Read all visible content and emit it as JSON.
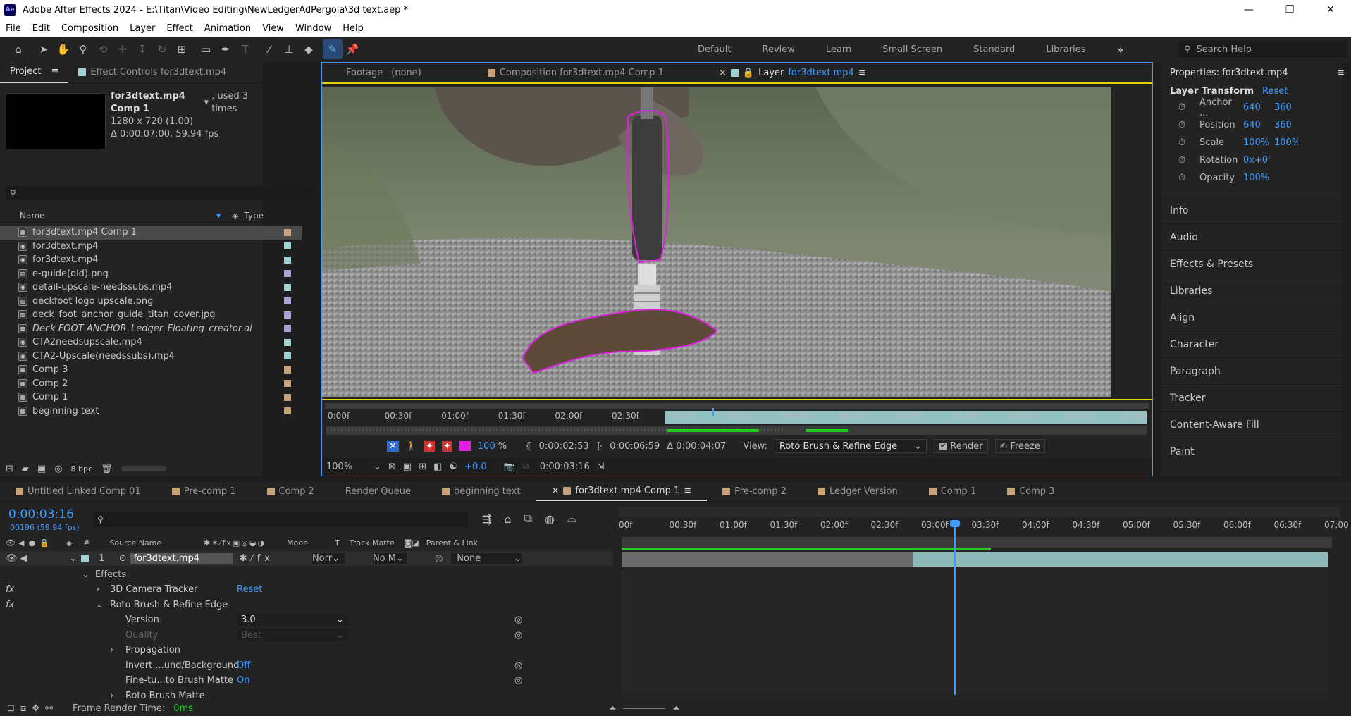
{
  "app": {
    "title": "Adobe After Effects 2024 - E:\\Titan\\Video Editing\\NewLedgerAdPergola\\3d text.aep *",
    "icon_text": "Ae",
    "window_buttons": [
      "—",
      "❐",
      "✕"
    ]
  },
  "menu": [
    "File",
    "Edit",
    "Composition",
    "Layer",
    "Effect",
    "Animation",
    "View",
    "Window",
    "Help"
  ],
  "workspaces": [
    "Default",
    "Review",
    "Learn",
    "Small Screen",
    "Standard",
    "Libraries"
  ],
  "workspace_more": "»",
  "search_help_placeholder": "Search Help",
  "project": {
    "tabs": [
      "Project",
      "Effect Controls for3dtext.mp4"
    ],
    "selected_name": "for3dtext.mp4 Comp 1",
    "used": ", used 3 times",
    "size": "1280 x 720 (1.00)",
    "duration": "Δ 0:00:07:00, 59.94 fps",
    "col_name": "Name",
    "col_type": "Type",
    "bpc": "8 bpc",
    "items": [
      {
        "name": "for3dtext.mp4 Comp 1",
        "kind": "comp",
        "color": "#c8a37a",
        "italic": false
      },
      {
        "name": "for3dtext.mp4",
        "kind": "video",
        "color": "#9fd3d3",
        "italic": false
      },
      {
        "name": "for3dtext.mp4",
        "kind": "video",
        "color": "#9fd3d3",
        "italic": false
      },
      {
        "name": "e-guide(old).png",
        "kind": "image",
        "color": "#a9a4d6",
        "italic": false
      },
      {
        "name": "detail-upscale-needssubs.mp4",
        "kind": "video",
        "color": "#9fd3d3",
        "italic": false
      },
      {
        "name": "deckfoot logo upscale.png",
        "kind": "image",
        "color": "#a9a4d6",
        "italic": false
      },
      {
        "name": "deck_foot_anchor_guide_titan_cover.jpg",
        "kind": "image",
        "color": "#a9a4d6",
        "italic": false
      },
      {
        "name": "Deck FOOT ANCHOR_Ledger_Floating_creator.ai",
        "kind": "ai",
        "color": "#a9a4d6",
        "italic": true
      },
      {
        "name": "CTA2needsupscale.mp4",
        "kind": "video",
        "color": "#9fd3d3",
        "italic": false
      },
      {
        "name": "CTA2-Upscale(needssubs).mp4",
        "kind": "video",
        "color": "#9fd3d3",
        "italic": false
      },
      {
        "name": "Comp 3",
        "kind": "comp",
        "color": "#c8a37a",
        "italic": false
      },
      {
        "name": "Comp 2",
        "kind": "comp",
        "color": "#c8a37a",
        "italic": false
      },
      {
        "name": "Comp 1",
        "kind": "comp",
        "color": "#c8a37a",
        "italic": false
      },
      {
        "name": "beginning text",
        "kind": "comp",
        "color": "#c8a37a",
        "italic": false
      }
    ]
  },
  "viewer": {
    "tabs": {
      "footage": "Footage",
      "footage_val": "(none)",
      "comp": "Composition for3dtext.mp4 Comp 1",
      "layer": "Layer",
      "layer_name": "for3dtext.mp4"
    },
    "ruler": [
      "0:00f",
      "00:30f",
      "01:00f",
      "01:30f",
      "02:00f",
      "02:30f",
      "03:00f",
      "03:30f",
      "04:00f",
      "04:30f",
      "05:00f",
      "05:30f",
      "06:00f",
      "06:30f",
      "07:00"
    ],
    "opacity": "100",
    "pct": "%",
    "in_time": "0:00:02:53",
    "out_time": "0:00:06:59",
    "delta": "Δ 0:00:04:07",
    "view_label": "View:",
    "view_value": "Roto Brush & Refine Edge",
    "render": "Render",
    "freeze": "Freeze",
    "zoom": "100%",
    "exposure": "+0.0",
    "current": "0:00:03:16",
    "colors": {
      "stroke": "#e020e0",
      "work": "#9fd3d3",
      "green": "#1fd01f",
      "blue": "#3e9bff"
    }
  },
  "properties": {
    "title": "Properties: for3dtext.mp4",
    "section": "Layer Transform",
    "reset": "Reset",
    "rows": [
      {
        "label": "Anchor ...",
        "v1": "640",
        "v2": "360"
      },
      {
        "label": "Position",
        "v1": "640",
        "v2": "360"
      },
      {
        "label": "Scale",
        "v1": "100%",
        "v2": "100%"
      },
      {
        "label": "Rotation",
        "v1": "0x+0°",
        "v2": ""
      },
      {
        "label": "Opacity",
        "v1": "100%",
        "v2": ""
      }
    ],
    "panels": [
      "Info",
      "Audio",
      "Effects & Presets",
      "Libraries",
      "Align",
      "Character",
      "Paragraph",
      "Tracker",
      "Content-Aware Fill",
      "Paint"
    ]
  },
  "timeline": {
    "tabs": [
      "Untitled Linked Comp 01",
      "Pre-comp 1",
      "Comp 2",
      "Render Queue",
      "beginning text",
      "for3dtext.mp4 Comp 1",
      "Pre-comp 2",
      "Ledger Version",
      "Comp 1",
      "Comp 3"
    ],
    "active_tab": 5,
    "timecode": "0:00:03:16",
    "frames": "00196 (59.94 fps)",
    "cols": {
      "num": "#",
      "source": "Source Name",
      "mode": "Mode",
      "t": "T",
      "matte": "Track Matte",
      "parent": "Parent & Link"
    },
    "ruler": [
      "00f",
      "00:30f",
      "01:00f",
      "01:30f",
      "02:00f",
      "02:30f",
      "03:00f",
      "03:30f",
      "04:00f",
      "04:30f",
      "05:00f",
      "05:30f",
      "06:00f",
      "06:30f",
      "07:00"
    ],
    "layer": {
      "num": "1",
      "name": "for3dtext.mp4",
      "mode": "Norr",
      "matte": "No M",
      "parent": "None"
    },
    "effects_label": "Effects",
    "fx": "fx",
    "props": [
      {
        "indent": 1,
        "fx": true,
        "label": "3D Camera Tracker",
        "value": "Reset",
        "value_kind": "link",
        "twirl": "›"
      },
      {
        "indent": 1,
        "fx": true,
        "label": "Roto Brush & Refine Edge",
        "value": "",
        "value_kind": "",
        "twirl": "⌄"
      },
      {
        "indent": 2,
        "fx": false,
        "label": "Version",
        "value": "3.0",
        "value_kind": "dropdown",
        "twirl": ""
      },
      {
        "indent": 2,
        "fx": false,
        "label": "Quality",
        "value": "Best",
        "value_kind": "dropdown-dim",
        "twirl": ""
      },
      {
        "indent": 2,
        "fx": false,
        "label": "Propagation",
        "value": "",
        "value_kind": "",
        "twirl": "›"
      },
      {
        "indent": 2,
        "fx": false,
        "label": "Invert ...und/Background",
        "value": "Off",
        "value_kind": "link",
        "twirl": ""
      },
      {
        "indent": 2,
        "fx": false,
        "label": "Fine-tu...to Brush Matte",
        "value": "On",
        "value_kind": "link",
        "twirl": ""
      },
      {
        "indent": 2,
        "fx": false,
        "label": "Roto Brush Matte",
        "value": "",
        "value_kind": "",
        "twirl": "›"
      }
    ],
    "frame_render_label": "Frame Render Time:",
    "frame_render_value": "0ms"
  }
}
